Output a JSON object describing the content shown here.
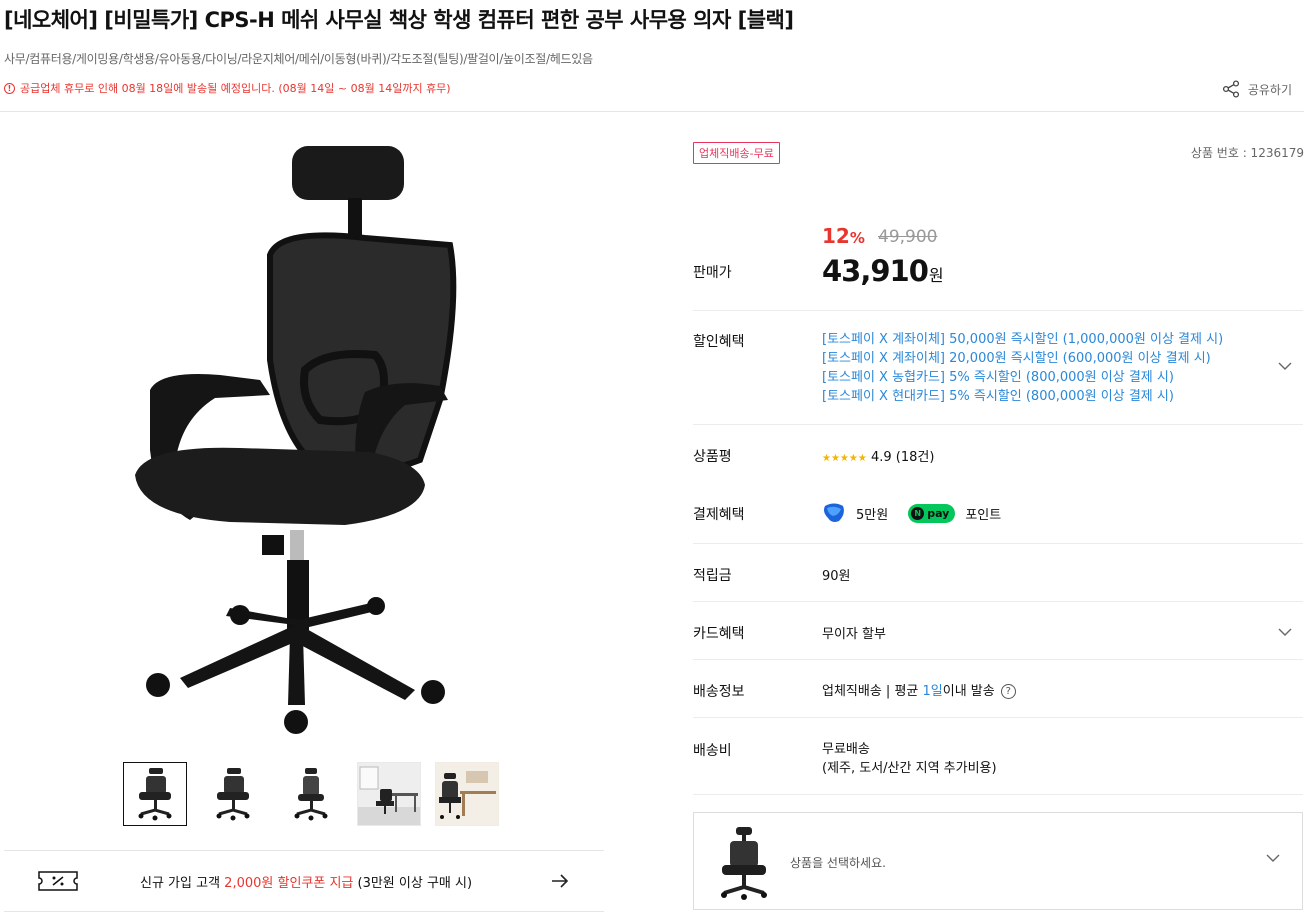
{
  "product": {
    "title": "[네오체어] [비밀특가] CPS-H 메쉬 사무실 책상 학생 컴퓨터 편한 공부 사무용 의자 [블랙]",
    "tags": "사무/컴퓨터용/게이밍용/학생용/유아동용/다이닝/라운지체어/메쉬/이동형(바퀴)/각도조절(틸팅)/팔걸이/높이조절/헤드있음",
    "notice_icon": "!",
    "notice": "공급업체 휴무로 인해 08월 18일에 발송될 예정입니다. (08월 14일 ~ 08월 14일까지 휴무)",
    "share_label": "공유하기",
    "shipping_badge": "업체직배송-무료",
    "product_number": "상품 번호 : 1236179"
  },
  "pricing": {
    "discount_value": "12",
    "discount_unit": "%",
    "original_price": "49,900",
    "label": "판매가",
    "price": "43,910",
    "won": "원"
  },
  "rows": {
    "benefits_label": "할인혜택",
    "benefits": [
      "[토스페이 X 계좌이체] 50,000원 즉시할인 (1,000,000원 이상 결제 시)",
      "[토스페이 X 계좌이체] 20,000원 즉시할인 (600,000원 이상 결제 시)",
      "[토스페이 X 농협카드] 5% 즉시할인 (800,000원 이상 결제 시)",
      "[토스페이 X 현대카드] 5% 즉시할인 (800,000원 이상 결제 시)"
    ],
    "review_label": "상품평",
    "stars": "★★★★★",
    "rating": "4.9",
    "review_count": "(18건)",
    "payment_label": "결제혜택",
    "toss_amount": "5만원",
    "npay_n": "N",
    "npay_label": "pay",
    "npay_text": "포인트",
    "points_label": "적립금",
    "points_value": "90원",
    "card_label": "카드혜택",
    "card_value": "무이자 할부",
    "delivery_label": "배송정보",
    "delivery_pre": "업체직배송 | 평균 ",
    "delivery_days": "1일",
    "delivery_post": "이내 발송",
    "help_icon": "?",
    "fee_label": "배송비",
    "fee_value": "무료배송",
    "fee_note": "(제주, 도서/산간 지역 추가비용)"
  },
  "coupon": {
    "pre": "신규 가입 고객 ",
    "highlight": "2,000원 할인쿠폰 지급",
    "post": " (3만원 이상 구매 시)"
  },
  "option": {
    "placeholder": "상품을 선택하세요."
  },
  "thumbnails": [
    "chair-front",
    "chair-side",
    "chair-back",
    "chair-room",
    "chair-desk"
  ],
  "colors": {
    "accent_red": "#e8362f",
    "link_blue": "#2b88d9",
    "badge_pink": "#e8365f",
    "npay_green": "#03c75a"
  }
}
